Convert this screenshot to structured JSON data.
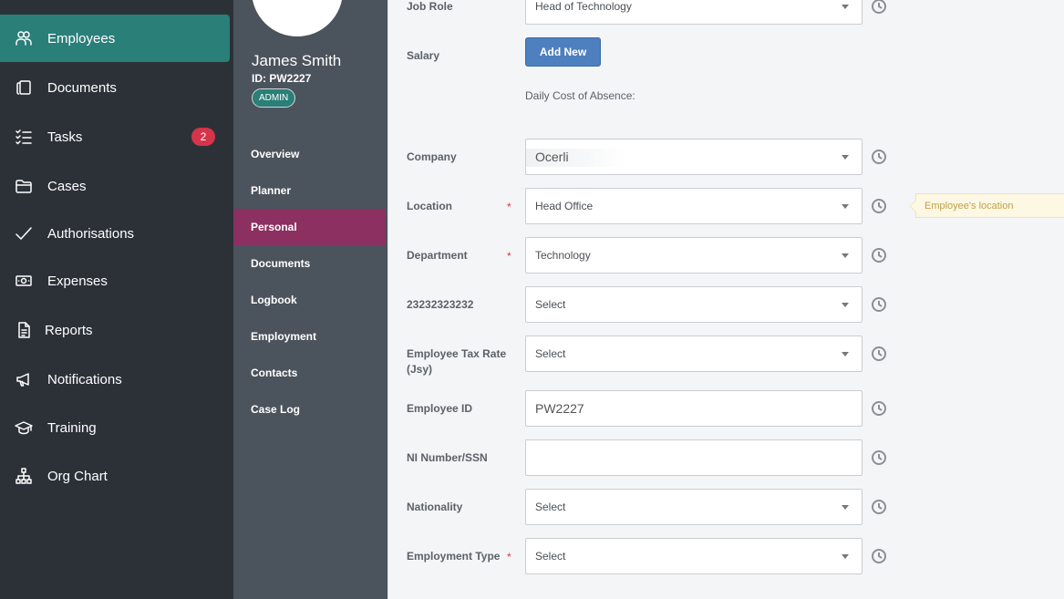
{
  "sidebar": {
    "items": [
      {
        "label": "Employees",
        "icon": "people-icon"
      },
      {
        "label": "Documents",
        "icon": "documents-icon"
      },
      {
        "label": "Tasks",
        "icon": "tasks-icon",
        "badge": "2"
      },
      {
        "label": "Cases",
        "icon": "folder-icon"
      },
      {
        "label": "Authorisations",
        "icon": "check-icon"
      },
      {
        "label": "Expenses",
        "icon": "money-icon"
      },
      {
        "label": "Reports",
        "icon": "report-icon"
      },
      {
        "label": "Notifications",
        "icon": "megaphone-icon"
      },
      {
        "label": "Training",
        "icon": "graduation-cap-icon"
      },
      {
        "label": "Org Chart",
        "icon": "org-chart-icon"
      }
    ],
    "active_color": "#2a7f78",
    "badge_color": "#d6344a"
  },
  "profile": {
    "name": "James Smith",
    "id": "ID: PW2227",
    "role": "ADMIN",
    "nav": [
      "Overview",
      "Planner",
      "Personal",
      "Documents",
      "Logbook",
      "Employment",
      "Contacts",
      "Case Log"
    ],
    "active_nav": "Personal",
    "active_color": "#8b3060"
  },
  "form": {
    "job_role": {
      "label": "Job Role",
      "value": "Head of Technology"
    },
    "salary": {
      "label": "Salary",
      "button": "Add New",
      "note": "Daily Cost of Absence:"
    },
    "company": {
      "label": "Company",
      "value": "Ocerli"
    },
    "location": {
      "label": "Location",
      "value": "Head Office",
      "required": "*",
      "tooltip": "Employee's location"
    },
    "department": {
      "label": "Department",
      "value": "Technology",
      "required": "*"
    },
    "custom_field": {
      "label": "23232323232",
      "value": "Select"
    },
    "tax_rate": {
      "label_line1": "Employee Tax Rate",
      "label_line2": "(Jsy)",
      "value": "Select"
    },
    "employee_id": {
      "label": "Employee ID",
      "value": "PW2227"
    },
    "ni_number": {
      "label": "NI Number/SSN",
      "value": ""
    },
    "nationality": {
      "label": "Nationality",
      "value": "Select"
    },
    "employment_type": {
      "label": "Employment Type",
      "value": "Select",
      "required": "*"
    }
  }
}
